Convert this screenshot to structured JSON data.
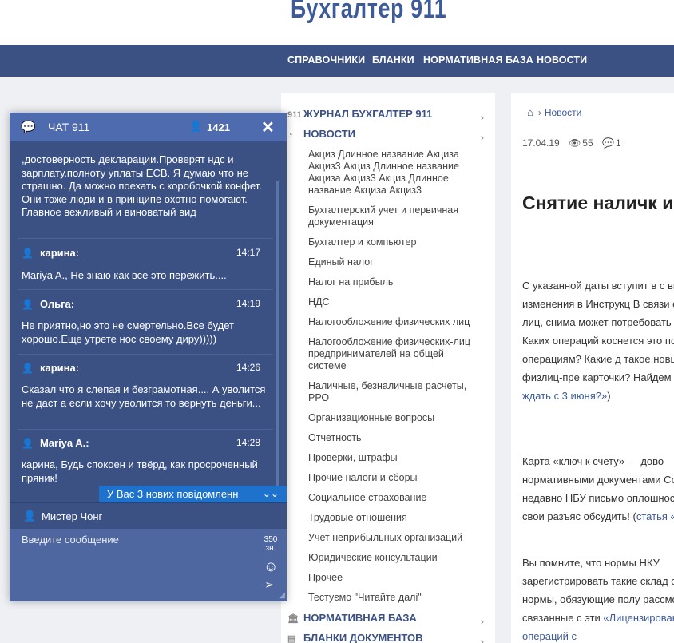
{
  "site": {
    "logo": "Бухгалтер 911"
  },
  "nav": [
    "СПРАВОЧНИКИ",
    "БЛАНКИ",
    "НОРМАТИВНАЯ БАЗА",
    "НОВОСТИ"
  ],
  "menu": {
    "sections": [
      {
        "label": "ЖУРНАЛ БУХГАЛТЕР 911",
        "icon": "logo-911-icon"
      },
      {
        "label": "НОВОСТИ",
        "icon": "rss-icon"
      },
      {
        "label": "НОРМАТИВНАЯ БАЗА",
        "icon": "institution-icon"
      },
      {
        "label": "БЛАНКИ ДОКУМЕНТОВ",
        "icon": "document-icon"
      }
    ],
    "items": [
      "Акциз Длинное название Акциза Акциз3 Акциз Длинное название Акциза Акциз3 Акциз Длинное название Акциза Акциз3",
      "Бухгалтерский учет и первичная документация",
      "Бухгалтер и компьютер",
      "Единый налог",
      "Налог на прибыль",
      "НДС",
      "Налогообложение физических лиц",
      "Налогообложение физических-лиц предпринимателей на общей системе",
      "Наличные, безналичные расчеты, РРО",
      "Организационные вопросы",
      "Отчетность",
      "Проверки, штрафы",
      "Прочие налоги и сборы",
      "Социальное страхование",
      "Трудовые отношения",
      "Учет неприбыльных организаций",
      "Юридические консультации",
      "Прочее",
      "Тестуємо \"Читайте далі\""
    ]
  },
  "article": {
    "breadcrumb": "Новости",
    "date": "17.04.19",
    "views": "55",
    "comments": "1",
    "title": "Снятие наличк июня?",
    "p1": "С указанной даты вступит в с внесет изменения в Инструкц В связи с этим от лиц, снима может потребовать документ Каких операций коснется это по таким операциям? Какие д такое новшество физлиц-пре карточки? Найдем ответы на",
    "p1_link": "ждать с 3 июня?»",
    "p1_tail": ")",
    "p2": "Карта «ключ к счету» — дово нормативными документами Совсем недавно НБУ письмо оплошность, дав свои разъяс обсудить! (",
    "p2_link": "статья «Карта «кл",
    "p3": "Вы помните, что нормы НКУ зарегистрировать такие склад силу нормы, обязующие полу рассмотреть связанные с эти",
    "p3_link": "«Лицензирование операций с"
  },
  "chat": {
    "title": "ЧАТ 911",
    "online": "1421",
    "first_message": ",достоверность декларации.Проверят ндс и зарплату.полноту уплаты ЕСВ. Я думаю что не страшно. Да можно поехать с коробочкой конфет. Они тоже люди и в принципе охотно помогают. Главное вежливый и виноватый вид",
    "messages": [
      {
        "author": "карина:",
        "time": "14:17",
        "text": "Mariya A., Не знаю как все это пережить...."
      },
      {
        "author": "Ольга:",
        "time": "14:19",
        "text": "Не приятно,но это не смертельно.Все будет хорошо.Еще утрете нос своему диру)))))"
      },
      {
        "author": "карина:",
        "time": "14:26",
        "text": "Сказал что я слепая и безграмотная.... А уволится не даст а если хочу уволится то вернуть деньги..."
      },
      {
        "author": "Mariya A.:",
        "time": "14:28",
        "text": "карина, Будь спокоен и твёрд, как просроченный пряник!"
      }
    ],
    "notice": "У Вас 3 нових повідомленн",
    "current_user": "Мистер Чонг",
    "input_placeholder": "Введите сообщение",
    "char_count": "350",
    "char_unit": "зн."
  }
}
